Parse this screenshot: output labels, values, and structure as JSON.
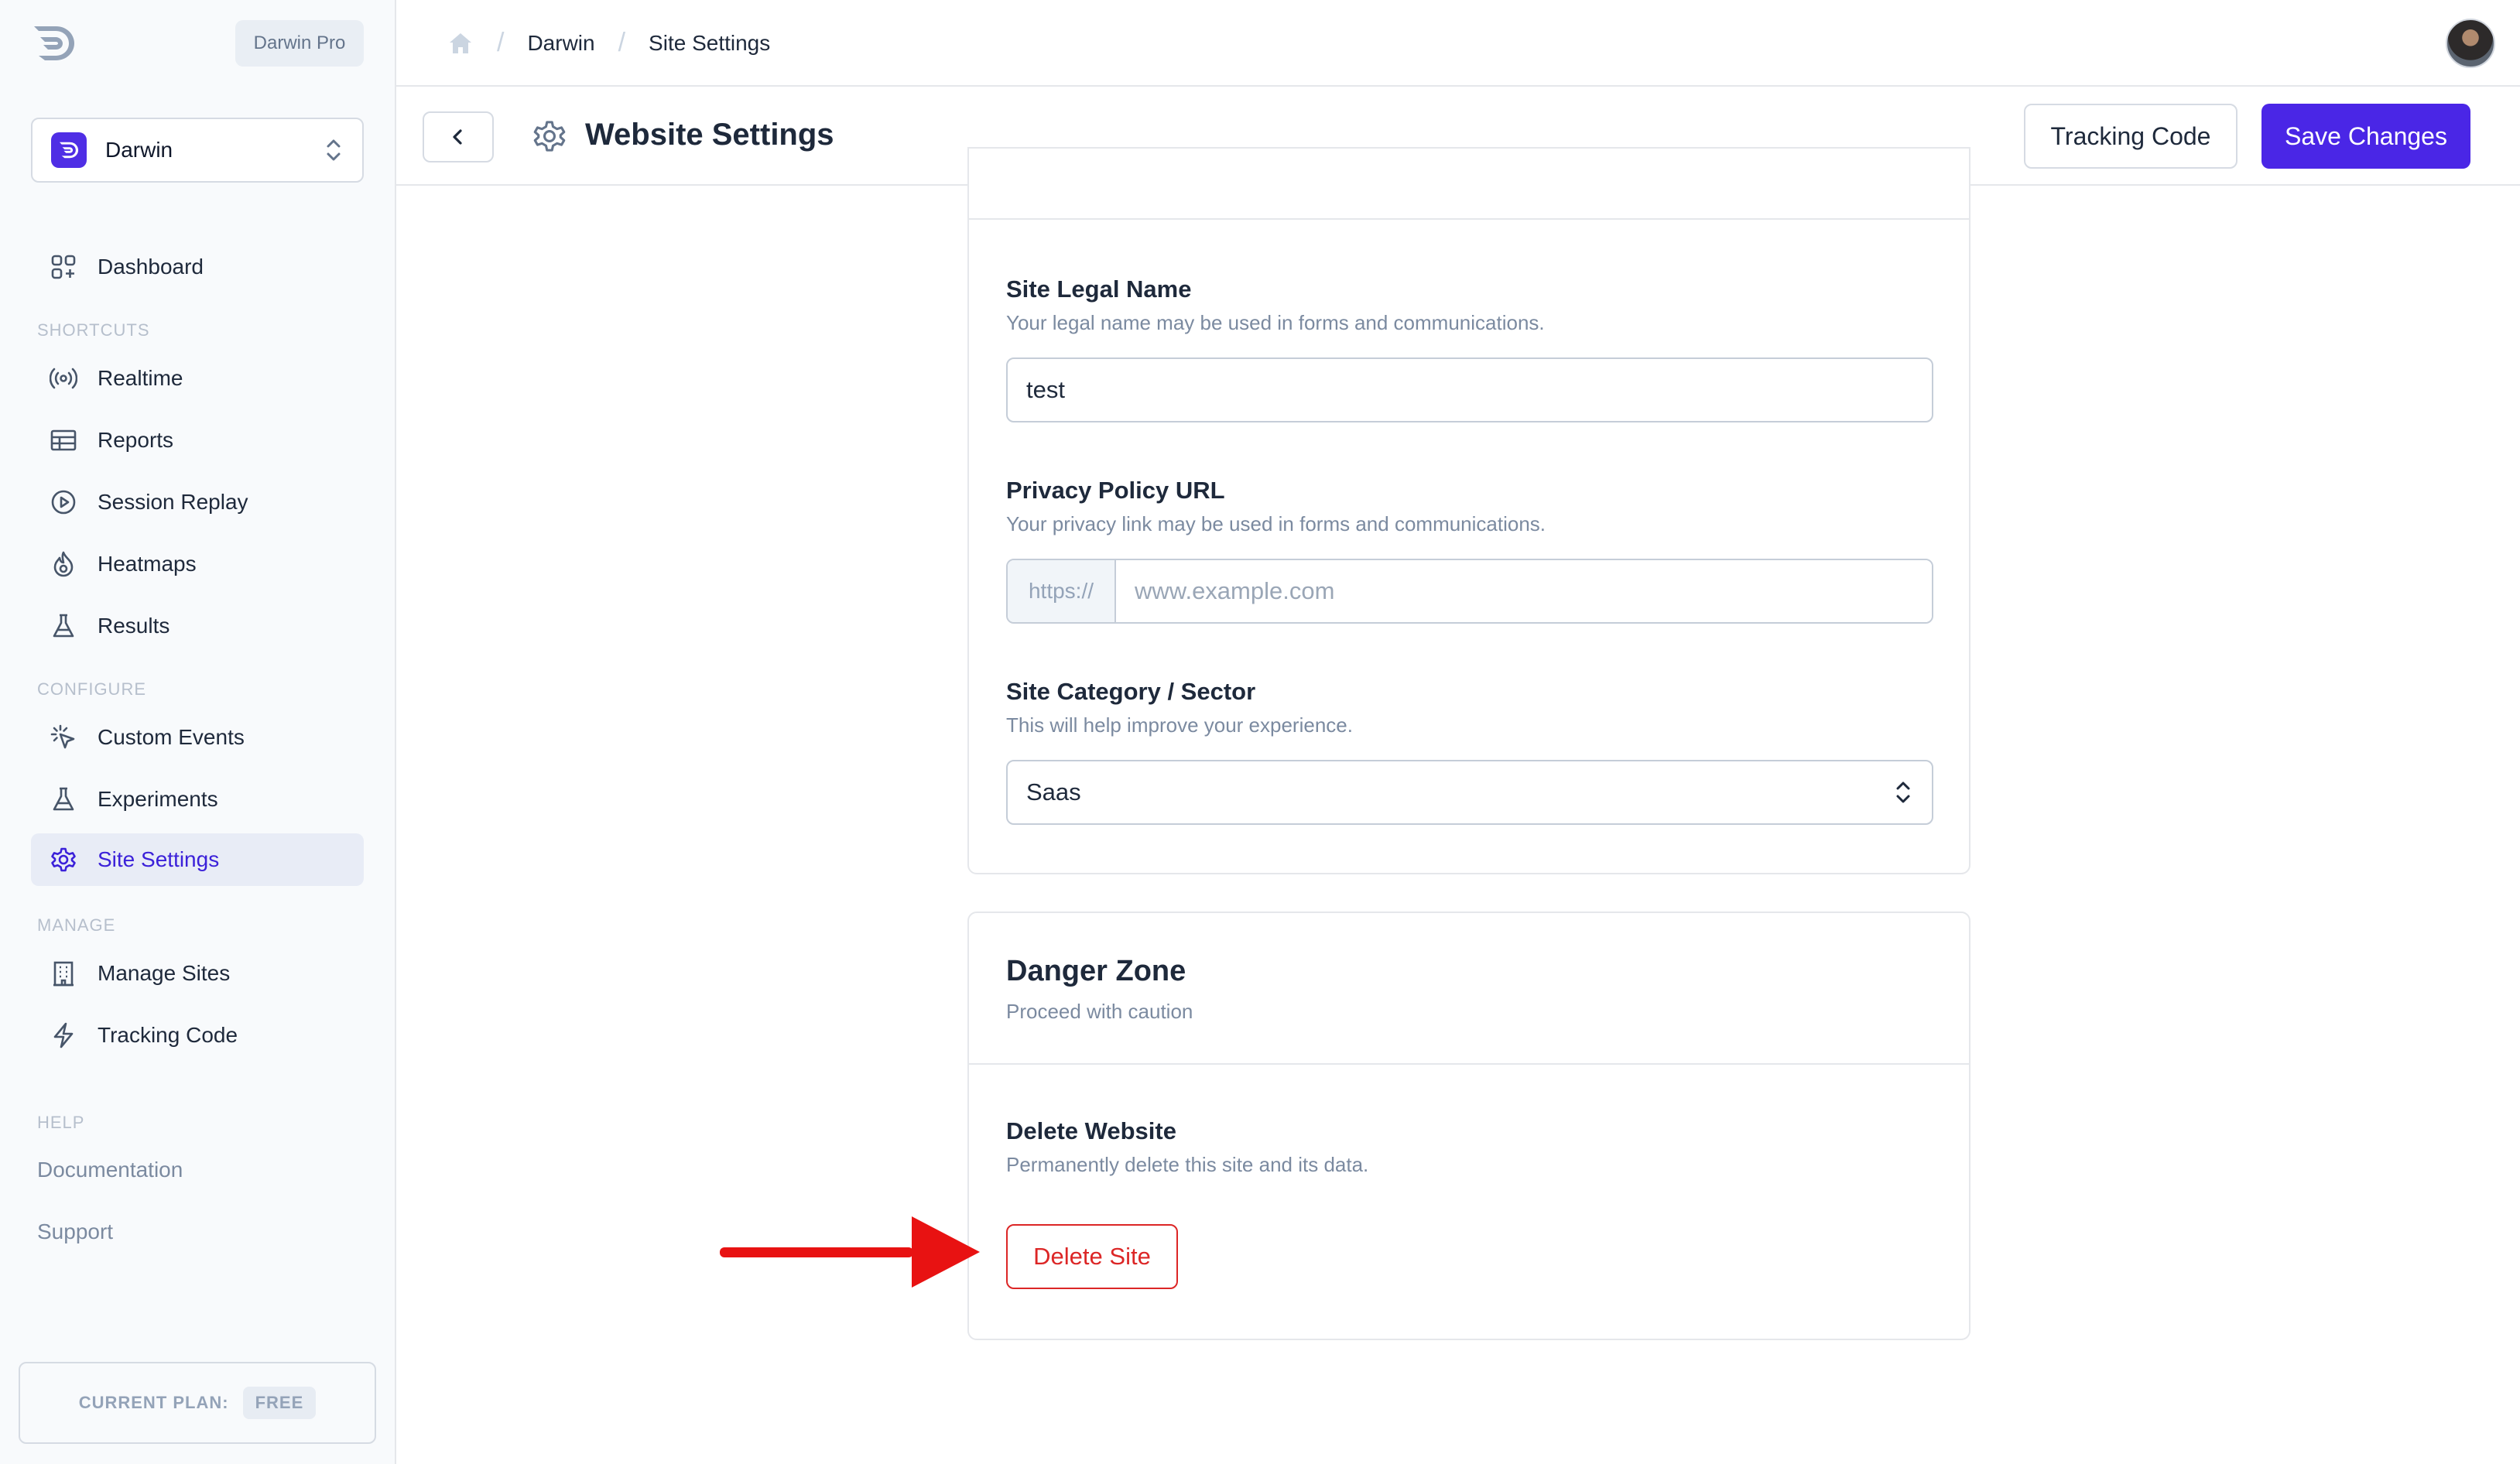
{
  "app": {
    "plan_pill": "Darwin Pro",
    "site_selector": {
      "name": "Darwin"
    }
  },
  "sidebar": {
    "dashboard": "Dashboard",
    "sections": {
      "shortcuts": "SHORTCUTS",
      "configure": "CONFIGURE",
      "manage": "MANAGE",
      "help": "HELP"
    },
    "shortcuts": [
      {
        "label": "Realtime",
        "icon": "broadcast-icon"
      },
      {
        "label": "Reports",
        "icon": "table-icon"
      },
      {
        "label": "Session Replay",
        "icon": "play-circle-icon"
      },
      {
        "label": "Heatmaps",
        "icon": "flame-icon"
      },
      {
        "label": "Results",
        "icon": "flask-icon"
      }
    ],
    "configure": [
      {
        "label": "Custom Events",
        "icon": "cursor-click-icon"
      },
      {
        "label": "Experiments",
        "icon": "flask-icon"
      },
      {
        "label": "Site Settings",
        "icon": "gear-icon",
        "active": true
      }
    ],
    "manage": [
      {
        "label": "Manage Sites",
        "icon": "building-icon"
      },
      {
        "label": "Tracking Code",
        "icon": "bolt-icon"
      }
    ],
    "help_links": [
      "Documentation",
      "Support"
    ],
    "current_plan": {
      "label": "CURRENT PLAN:",
      "value": "FREE"
    }
  },
  "header": {
    "breadcrumbs": [
      "Darwin",
      "Site Settings"
    ]
  },
  "toolbar": {
    "title": "Website Settings",
    "tracking_code_label": "Tracking Code",
    "save_label": "Save Changes"
  },
  "settings": {
    "legal_name": {
      "label": "Site Legal Name",
      "help": "Your legal name may be used in forms and communications.",
      "value": "test"
    },
    "privacy_url": {
      "label": "Privacy Policy URL",
      "help": "Your privacy link may be used in forms and communications.",
      "prefix": "https://",
      "placeholder": "www.example.com",
      "value": ""
    },
    "category": {
      "label": "Site Category / Sector",
      "help": "This will help improve your experience.",
      "value": "Saas"
    }
  },
  "danger_zone": {
    "title": "Danger Zone",
    "subtitle": "Proceed with caution",
    "delete_label": "Delete Website",
    "delete_help": "Permanently delete this site and its data.",
    "delete_button": "Delete Site"
  },
  "colors": {
    "accent": "#4a26e6",
    "danger": "#dc2626",
    "annotation_arrow": "#e81212"
  }
}
